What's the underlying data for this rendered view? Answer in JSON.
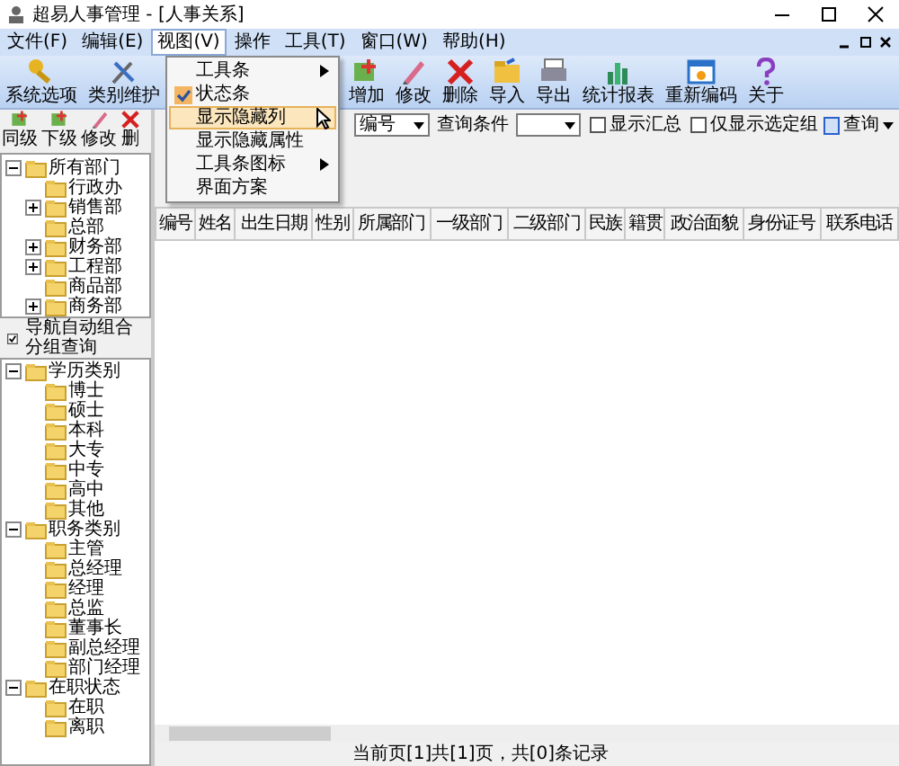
{
  "window": {
    "title": "超易人事管理 - [人事关系]"
  },
  "menu": [
    {
      "label": "文件(F)",
      "selected": false
    },
    {
      "label": "编辑(E)",
      "selected": false
    },
    {
      "label": "视图(V)",
      "selected": true
    },
    {
      "label": "操作",
      "selected": false
    },
    {
      "label": "工具(T)",
      "selected": false
    },
    {
      "label": "窗口(W)",
      "selected": false
    },
    {
      "label": "帮助(H)",
      "selected": false
    }
  ],
  "toolbar": [
    "系统选项",
    "类别维护",
    "增加",
    "修改",
    "删除",
    "导入",
    "导出",
    "统计报表",
    "重新编码",
    "关于"
  ],
  "view_menu": [
    {
      "label": "工具条",
      "kind": "submenu",
      "checked": false,
      "selected": false
    },
    {
      "label": "状态条",
      "kind": "item",
      "checked": true,
      "selected": false
    },
    {
      "label": "显示隐藏列",
      "kind": "item",
      "checked": false,
      "selected": true
    },
    {
      "label": "显示隐藏属性",
      "kind": "item",
      "checked": false,
      "selected": false
    },
    {
      "label": "工具条图标",
      "kind": "submenu",
      "checked": false,
      "selected": false
    },
    {
      "label": "界面方案",
      "kind": "item",
      "checked": false,
      "selected": false
    }
  ],
  "nav_toolbar": [
    "同级",
    "下级",
    "修改",
    "删"
  ],
  "department_tree": [
    {
      "label": "所有部门",
      "expanded": true,
      "children": [
        {
          "label": "行政办"
        },
        {
          "label": "销售部",
          "expanded": false
        },
        {
          "label": "总部"
        },
        {
          "label": "财务部",
          "expanded": false
        },
        {
          "label": "工程部",
          "expanded": false
        },
        {
          "label": "商品部"
        },
        {
          "label": "商务部",
          "expanded": false
        }
      ]
    }
  ],
  "auto_group": {
    "label": "导航自动组合分组查询",
    "checked": true
  },
  "category_tree": [
    {
      "label": "学历类别",
      "expanded": true,
      "children": [
        {
          "label": "博士"
        },
        {
          "label": "硕士"
        },
        {
          "label": "本科"
        },
        {
          "label": "大专"
        },
        {
          "label": "中专"
        },
        {
          "label": "高中"
        },
        {
          "label": "其他"
        }
      ]
    },
    {
      "label": "职务类别",
      "expanded": true,
      "children": [
        {
          "label": "主管"
        },
        {
          "label": "总经理"
        },
        {
          "label": "经理"
        },
        {
          "label": "总监"
        },
        {
          "label": "董事长"
        },
        {
          "label": "副总经理"
        },
        {
          "label": "部门经理"
        }
      ]
    },
    {
      "label": "在职状态",
      "expanded": true,
      "children": [
        {
          "label": "在职"
        },
        {
          "label": "离职"
        }
      ]
    }
  ],
  "query_bar": {
    "field": "编号",
    "condition_label": "查询条件",
    "show_summary": {
      "label": "显示汇总",
      "checked": false
    },
    "selected_only": {
      "label": "仅显示选定组",
      "checked": false
    },
    "query_button": "查询"
  },
  "table": {
    "columns": [
      "编号",
      "姓名",
      "出生日期",
      "性别",
      "所属部门",
      "一级部门",
      "二级部门",
      "民族",
      "籍贯",
      "政治面貌",
      "身份证号",
      "联系电话"
    ]
  },
  "status_bar": "当前页[1]共[1]页，共[0]条记录"
}
